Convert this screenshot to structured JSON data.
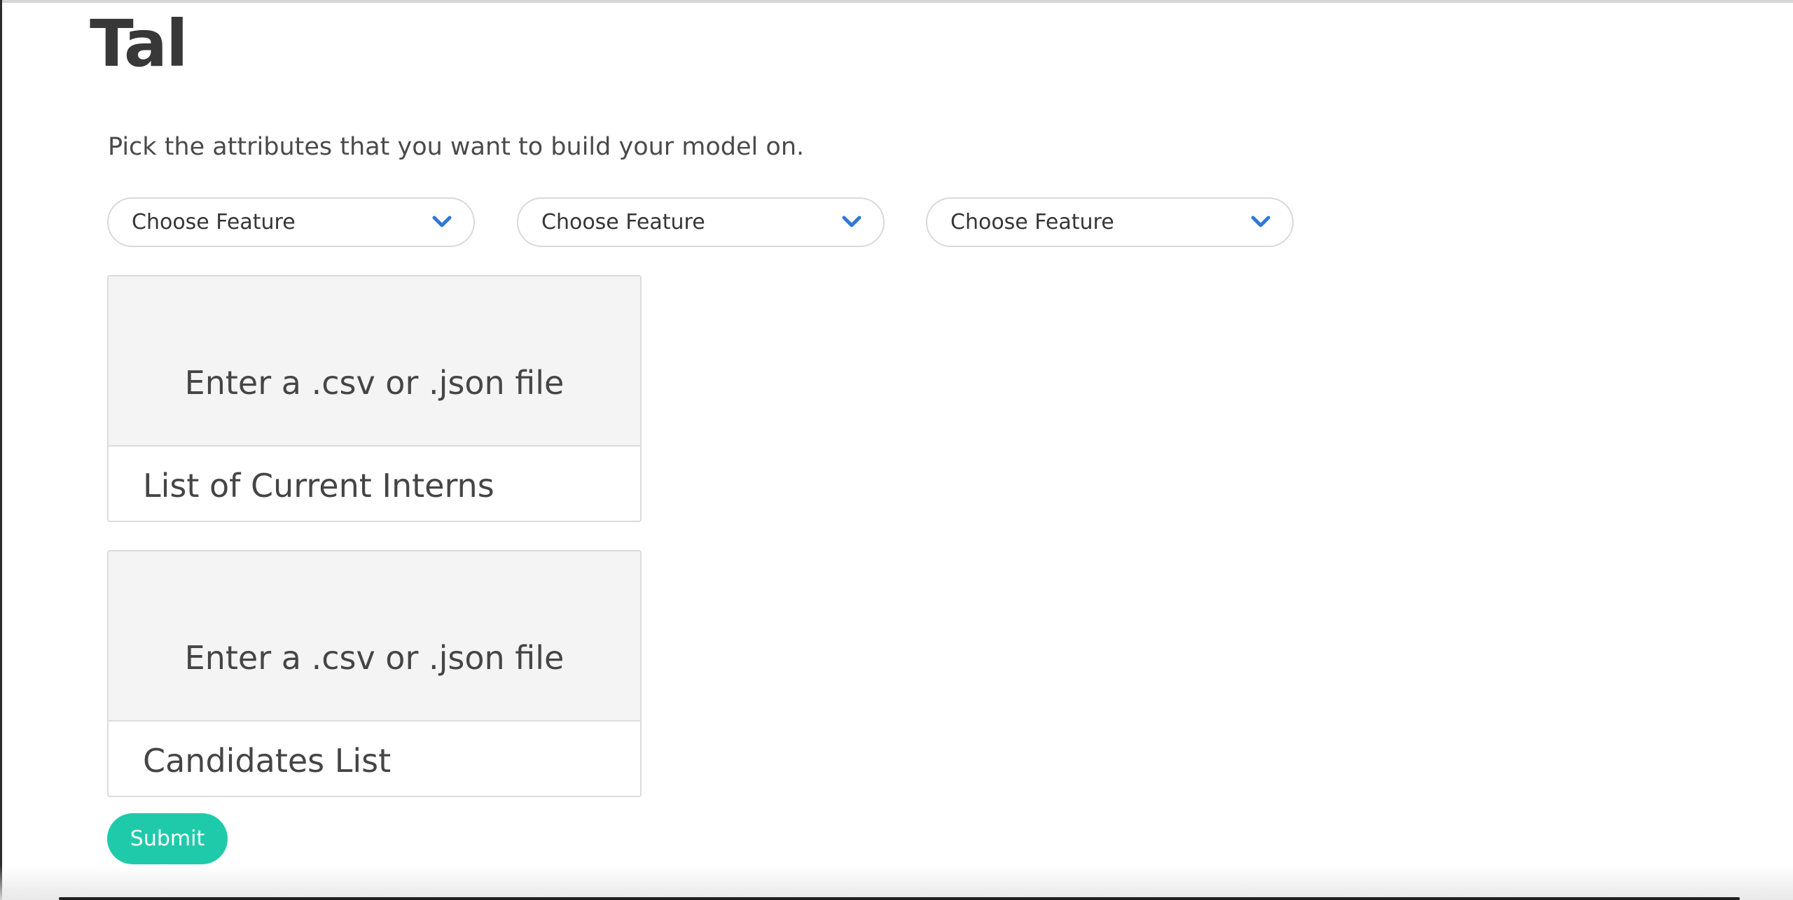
{
  "page": {
    "title": "Tal",
    "instruction": "Pick the attributes that you want to build your model on."
  },
  "feature_selects": [
    {
      "label": "Choose Feature",
      "icon": "chevron-down-icon"
    },
    {
      "label": "Choose Feature",
      "icon": "chevron-down-icon"
    },
    {
      "label": "Choose Feature",
      "icon": "chevron-down-icon"
    }
  ],
  "uploads": [
    {
      "prompt": "Enter a .csv or .json file",
      "label": "List of Current Interns"
    },
    {
      "prompt": "Enter a .csv or .json file",
      "label": "Candidates List"
    }
  ],
  "submit_label": "Submit",
  "colors": {
    "accent": "#1fcaaa",
    "chevron": "#2f78d6",
    "text": "#3a3a3a",
    "drop_zone_bg": "#f4f4f4"
  }
}
